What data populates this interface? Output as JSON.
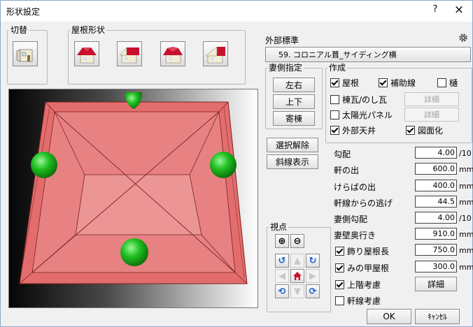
{
  "window": {
    "title": "形状設定",
    "help": "?",
    "close": "×"
  },
  "kirikae": {
    "label": "切替"
  },
  "roof_shape": {
    "label": "屋根形状"
  },
  "exterior": {
    "label": "外部標準",
    "select_value": "59. コロニアル葺_サイディング横",
    "gear_icon": "gear-icon"
  },
  "gable": {
    "label": "妻側指定",
    "buttons": [
      "左右",
      "上下",
      "寄棟"
    ]
  },
  "create": {
    "label": "作成",
    "yane": "屋根",
    "hojosen": "補助線",
    "toi": "樋",
    "munegawara": "棟瓦/のし瓦",
    "taiyoko": "太陽光パネル",
    "gaibu_tenjo": "外部天井",
    "zumenka": "図面化",
    "detail1": "詳細",
    "detail2": "詳細"
  },
  "actions": {
    "select_clear": "選択解除",
    "slope_display": "斜線表示"
  },
  "params": [
    {
      "label": "勾配",
      "value": "4.00",
      "unit": "/10"
    },
    {
      "label": "軒の出",
      "value": "600.0",
      "unit": "mm"
    },
    {
      "label": "けらばの出",
      "value": "400.0",
      "unit": "mm"
    },
    {
      "label": "軒線からの逃げ",
      "value": "44.5",
      "unit": "mm"
    },
    {
      "label": "妻側勾配",
      "value": "4.00",
      "unit": "/10"
    },
    {
      "label": "妻壁奥行き",
      "value": "910.0",
      "unit": "mm"
    }
  ],
  "options": {
    "kazari": {
      "label": "飾り屋根長",
      "value": "750.0",
      "unit": "mm"
    },
    "minoko": {
      "label": "みの甲屋根",
      "value": "300.0",
      "unit": "mm"
    },
    "jokai": {
      "label": "上階考慮"
    },
    "nokisen": {
      "label": "軒線考慮"
    },
    "detail_button": "詳細"
  },
  "view": {
    "label": "視点"
  },
  "footer": {
    "ok": "OK",
    "cancel": "ｷｬﾝｾﾙ"
  },
  "colors": {
    "roof_red": "#c8102e",
    "roof_fill": "#e26a6a",
    "handle_green": "#21c021"
  }
}
